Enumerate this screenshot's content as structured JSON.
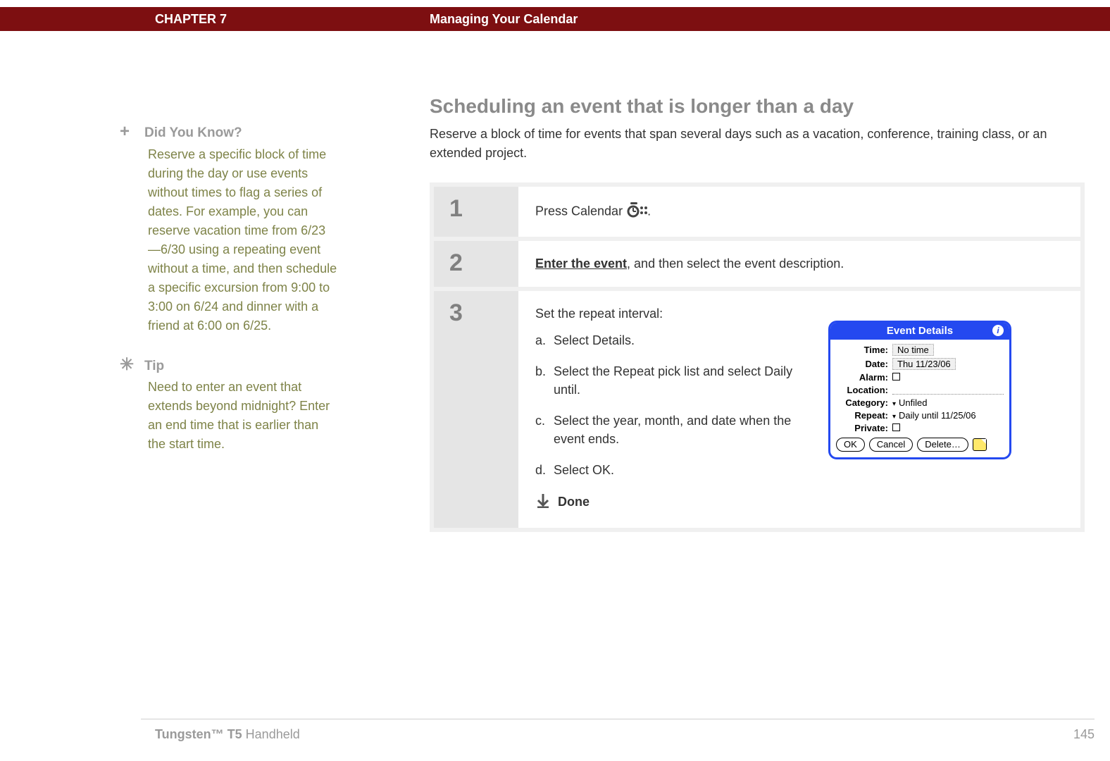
{
  "header": {
    "chapter": "CHAPTER 7",
    "title": "Managing Your Calendar"
  },
  "sidebar": {
    "dyk": {
      "icon": "plus-icon",
      "head": "Did You Know?",
      "body": "Reserve a specific block of time during the day or use events without times to flag a series of dates. For example, you can reserve vacation time from 6/23—6/30 using a repeating event without a time, and then schedule a specific excursion from 9:00 to 3:00 on 6/24 and dinner with a friend at 6:00 on 6/25."
    },
    "tip": {
      "icon": "asterisk-icon",
      "head": "Tip",
      "body": "Need to enter an event that extends beyond midnight? Enter an end time that is earlier than the start time."
    }
  },
  "main": {
    "title": "Scheduling an event that is longer than a day",
    "intro": "Reserve a block of time for events that span several days such as a vacation, conference, training class, or an extended project."
  },
  "steps": [
    {
      "num": "1",
      "text_before": "Press Calendar ",
      "text_after": "."
    },
    {
      "num": "2",
      "link": "Enter the event",
      "text_after": ", and then select the event description."
    },
    {
      "num": "3",
      "lead": "Set the repeat interval:",
      "subs": [
        {
          "letter": "a.",
          "text": "Select Details."
        },
        {
          "letter": "b.",
          "text": "Select the Repeat pick list and select Daily until."
        },
        {
          "letter": "c.",
          "text": "Select the year, month, and date when the event ends."
        },
        {
          "letter": "d.",
          "text": "Select OK."
        }
      ],
      "done": "Done"
    }
  ],
  "dialog": {
    "title": "Event Details",
    "rows": {
      "time_label": "Time:",
      "time_value": "No time",
      "date_label": "Date:",
      "date_value": "Thu 11/23/06",
      "alarm_label": "Alarm:",
      "location_label": "Location:",
      "category_label": "Category:",
      "category_value": "Unfiled",
      "repeat_label": "Repeat:",
      "repeat_value": "Daily until 11/25/06",
      "private_label": "Private:"
    },
    "buttons": {
      "ok": "OK",
      "cancel": "Cancel",
      "delete": "Delete…"
    }
  },
  "footer": {
    "device_strong": "Tungsten™ T5",
    "device_rest": " Handheld",
    "page": "145"
  }
}
